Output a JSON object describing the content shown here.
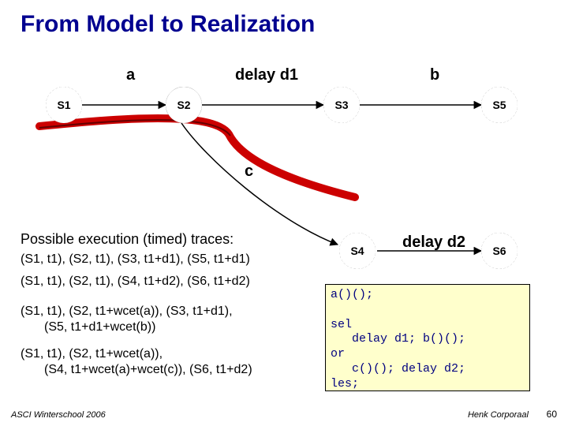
{
  "title": "From Model to Realization",
  "states": {
    "S1": "S1",
    "S2": "S2",
    "S3": "S3",
    "S4": "S4",
    "S5": "S5",
    "S6": "S6"
  },
  "edge_labels": {
    "a": "a",
    "delay_d1": "delay d1",
    "b": "b",
    "c": "c",
    "delay_d2": "delay d2"
  },
  "traces_heading": "Possible execution (timed) traces:",
  "traces": {
    "t1": "(S1, t1), (S2, t1), (S3, t1+d1), (S5, t1+d1)",
    "t2": "(S1, t1), (S2, t1), (S4, t1+d2), (S6, t1+d2)",
    "t3a": "(S1, t1), (S2, t1+wcet(a)), (S3, t1+d1),",
    "t3b": "(S5, t1+d1+wcet(b))",
    "t4a": "(S1, t1), (S2, t1+wcet(a)),",
    "t4b": "(S4, t1+wcet(a)+wcet(c)), (S6, t1+d2)"
  },
  "code": "a()();\n\nsel\n   delay d1; b()();\nor\n   c()(); delay d2;\nles;",
  "footer": {
    "left": "ASCI Winterschool 2006",
    "right": "Henk Corporaal",
    "page": "60"
  },
  "colors": {
    "title": "#000090",
    "redstroke": "#cc0000",
    "codebg": "#ffffcc",
    "codefg": "#000080"
  },
  "chart_data": {
    "type": "diagram",
    "nodes": [
      "S1",
      "S2",
      "S3",
      "S4",
      "S5",
      "S6"
    ],
    "edges": [
      {
        "from": "S1",
        "to": "S2",
        "label": "a"
      },
      {
        "from": "S2",
        "to": "S3",
        "label": "delay d1"
      },
      {
        "from": "S3",
        "to": "S5",
        "label": "b"
      },
      {
        "from": "S2",
        "to": "S4",
        "label": "c"
      },
      {
        "from": "S4",
        "to": "S6",
        "label": "delay d2"
      }
    ],
    "highlight_path": [
      "S1",
      "S2",
      "S4"
    ],
    "highlight_color": "#cc0000"
  }
}
